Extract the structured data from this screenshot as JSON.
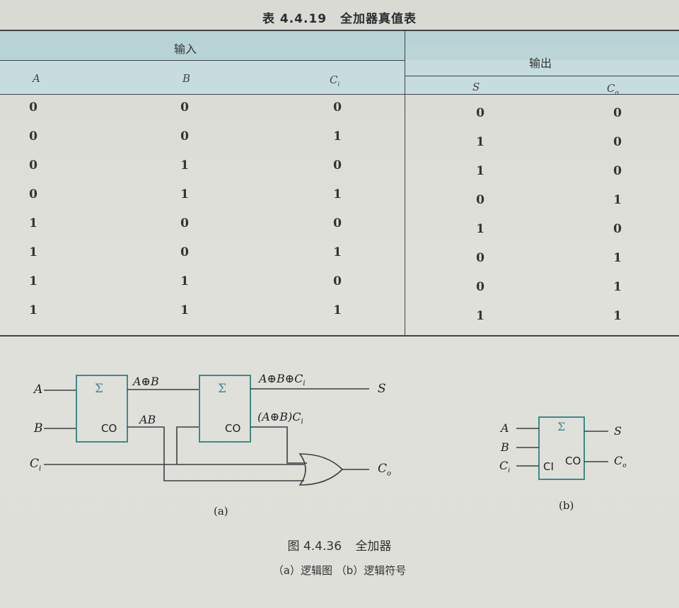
{
  "table_title": {
    "number": "表 4.4.19",
    "text": "全加器真值表"
  },
  "table": {
    "group_headers": {
      "input": "输入",
      "output": "输出"
    },
    "columns": [
      "A",
      "B",
      "C",
      "S",
      "C"
    ],
    "column_subscripts": [
      "",
      "",
      "i",
      "",
      "o"
    ],
    "rows": [
      [
        "0",
        "0",
        "0",
        "0",
        "0"
      ],
      [
        "0",
        "0",
        "1",
        "1",
        "0"
      ],
      [
        "0",
        "1",
        "0",
        "1",
        "0"
      ],
      [
        "0",
        "1",
        "1",
        "0",
        "1"
      ],
      [
        "1",
        "0",
        "0",
        "1",
        "0"
      ],
      [
        "1",
        "0",
        "1",
        "0",
        "1"
      ],
      [
        "1",
        "1",
        "0",
        "0",
        "1"
      ],
      [
        "1",
        "1",
        "1",
        "1",
        "1"
      ]
    ]
  },
  "diagram_a": {
    "inputs": [
      "A",
      "B",
      "C"
    ],
    "input_subscripts": [
      "",
      "",
      "i"
    ],
    "gate1": {
      "sigma": "Σ",
      "co": "CO"
    },
    "gate2": {
      "sigma": "Σ",
      "co": "CO"
    },
    "labels": {
      "a_xor_b": "A⊕B",
      "ab": "AB",
      "sum_expr": "A⊕B⊕C",
      "sum_sub": "i",
      "carry_expr": "(A⊕B)C",
      "carry_sub": "i"
    },
    "outputs": {
      "s": "S",
      "co": "C",
      "co_sub": "o"
    },
    "caption": "(a)"
  },
  "diagram_b": {
    "inputs": [
      "A",
      "B",
      "C"
    ],
    "input_subscripts": [
      "",
      "",
      "i"
    ],
    "sigma": "Σ",
    "ci": "CI",
    "co": "CO",
    "outputs": {
      "s": "S",
      "co": "C",
      "co_sub": "o"
    },
    "caption": "(b)"
  },
  "figure_caption": {
    "number": "图 4.4.36",
    "title": "全加器",
    "sub": "（a）逻辑图  （b）逻辑符号"
  }
}
